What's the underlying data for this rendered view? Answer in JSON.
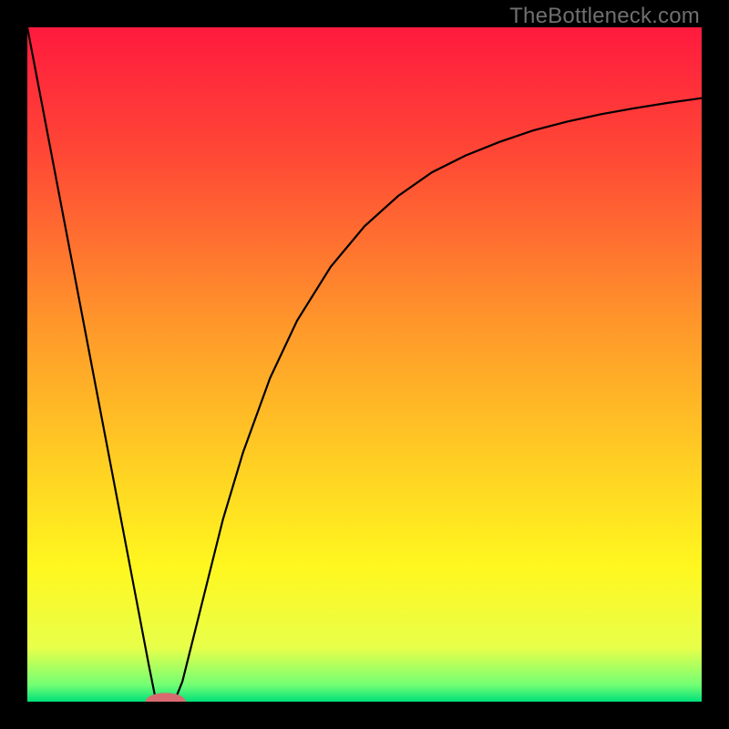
{
  "watermark": "TheBottleneck.com",
  "chart_data": {
    "type": "line",
    "title": "",
    "xlabel": "",
    "ylabel": "",
    "xlim": [
      0,
      100
    ],
    "ylim": [
      0,
      100
    ],
    "gradient_stops": [
      {
        "offset": 0.0,
        "color": "#ff1a3e"
      },
      {
        "offset": 0.2,
        "color": "#ff4b35"
      },
      {
        "offset": 0.45,
        "color": "#ff9a2a"
      },
      {
        "offset": 0.65,
        "color": "#ffd023"
      },
      {
        "offset": 0.8,
        "color": "#fff71f"
      },
      {
        "offset": 0.92,
        "color": "#e8ff4a"
      },
      {
        "offset": 0.975,
        "color": "#73ff73"
      },
      {
        "offset": 1.0,
        "color": "#00e07a"
      }
    ],
    "series": [
      {
        "name": "curve",
        "color": "#000000",
        "x": [
          0,
          2,
          4,
          6,
          8,
          10,
          12,
          14,
          16,
          18,
          19,
          20,
          21,
          22,
          23,
          24,
          25,
          27,
          29,
          32,
          36,
          40,
          45,
          50,
          55,
          60,
          65,
          70,
          75,
          80,
          85,
          90,
          95,
          100
        ],
        "y": [
          100,
          89.5,
          79,
          68.5,
          58,
          47.5,
          37,
          26.5,
          16,
          5.5,
          0.5,
          0,
          0,
          0.5,
          3,
          7,
          11,
          19,
          27,
          37,
          48,
          56.5,
          64.5,
          70.5,
          75,
          78.5,
          81,
          83,
          84.7,
          86,
          87.1,
          88,
          88.8,
          89.5
        ]
      }
    ],
    "marker": {
      "x": 20.5,
      "y": 0,
      "rx": 3.0,
      "ry": 1.3,
      "color": "#d86b6f"
    }
  }
}
